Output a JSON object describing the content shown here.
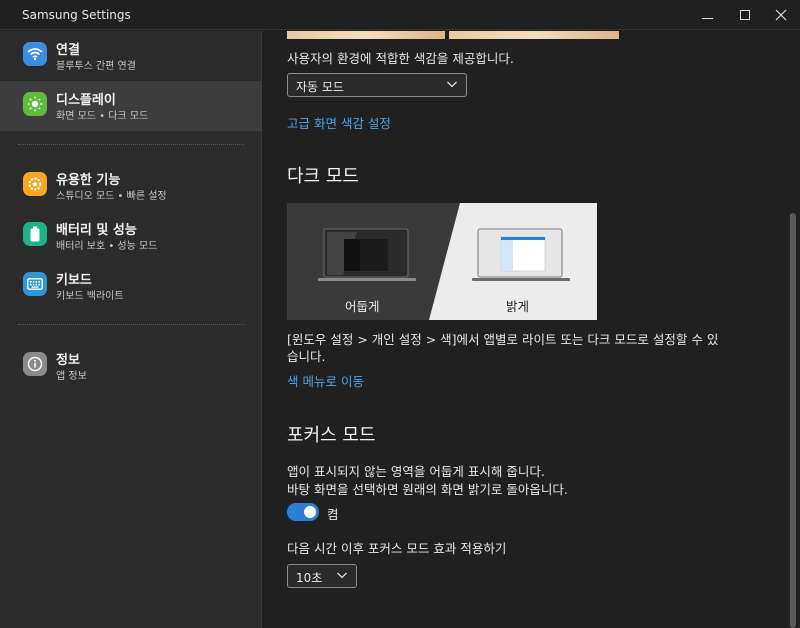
{
  "window": {
    "title": "Samsung Settings"
  },
  "sidebar": {
    "items": [
      {
        "title": "연결",
        "subtitle": "블루투스 간편 연결",
        "icon": "wifi-icon",
        "color": "#3b8de0"
      },
      {
        "title": "디스플레이",
        "subtitle": "화면 모드 • 다크 모드",
        "icon": "sun-icon",
        "color": "#5dbb3e"
      },
      {
        "title": "유용한 기능",
        "subtitle": "스튜디오 모드 • 빠른 설정",
        "icon": "star-gear-icon",
        "color": "#f5a623"
      },
      {
        "title": "배터리 및 성능",
        "subtitle": "배터리 보호 • 성능 모드",
        "icon": "battery-icon",
        "color": "#1cb38b"
      },
      {
        "title": "키보드",
        "subtitle": "키보드 백라이트",
        "icon": "keyboard-icon",
        "color": "#2f96d8"
      },
      {
        "title": "정보",
        "subtitle": "앱 정보",
        "icon": "info-icon",
        "color": "#8a8a8a"
      }
    ]
  },
  "screen_mode": {
    "description": "사용자의 환경에 적합한 색감을 제공합니다.",
    "selected": "자동 모드",
    "advanced_link": "고급 화면 색감 설정"
  },
  "dark_mode": {
    "heading": "다크 모드",
    "dark_label": "어둡게",
    "light_label": "밝게",
    "note_line1": "[윈도우 설정 > 개인 설정 > 색]에서 앱별로 라이트 또는 다크 모드로 설정할 수 있",
    "note_line2": "습니다.",
    "color_menu_link": "색 메뉴로 이동"
  },
  "focus_mode": {
    "heading": "포커스 모드",
    "desc_line1": "앱이 표시되지 않는 영역을 어둡게 표시해 줍니다.",
    "desc_line2": "바탕 화면을 선택하면 원래의 화면 밝기로 돌아옵니다.",
    "toggle_state": "켬",
    "toggle_on": true,
    "delay_label": "다음 시간 이후 포커스 모드 효과 적용하기",
    "delay_value": "10초"
  },
  "colors": {
    "accent": "#2b7fd4",
    "link": "#4aa3e8"
  }
}
